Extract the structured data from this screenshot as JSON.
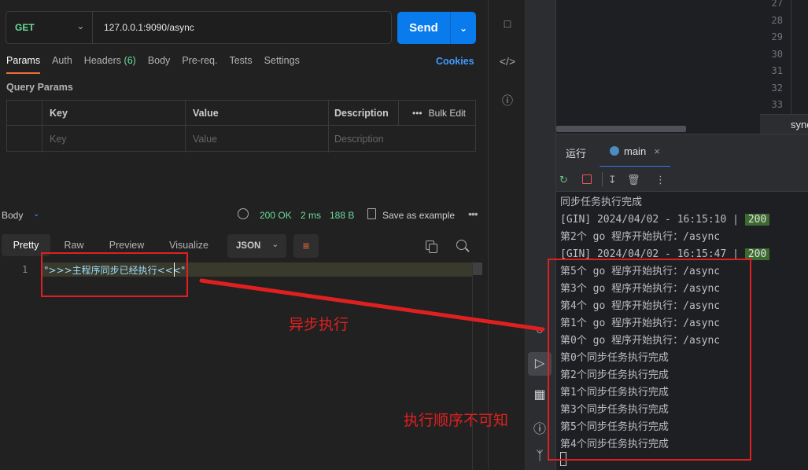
{
  "request": {
    "method": "GET",
    "url": "127.0.0.1:9090/async",
    "send_label": "Send"
  },
  "tabs": [
    {
      "label": "Params"
    },
    {
      "label": "Auth"
    },
    {
      "label": "Headers",
      "count": "(6)"
    },
    {
      "label": "Body"
    },
    {
      "label": "Pre-req."
    },
    {
      "label": "Tests"
    },
    {
      "label": "Settings"
    }
  ],
  "cookies_label": "Cookies",
  "query_params": {
    "title": "Query Params",
    "headers": {
      "key": "Key",
      "value": "Value",
      "description": "Description",
      "bulk_edit": "Bulk Edit"
    },
    "placeholders": {
      "key": "Key",
      "value": "Value",
      "description": "Description"
    }
  },
  "response": {
    "body_label": "Body",
    "status": "200 OK",
    "time": "2 ms",
    "size": "188 B",
    "save_label": "Save as example",
    "view_tabs": [
      "Pretty",
      "Raw",
      "Preview",
      "Visualize"
    ],
    "format": "JSON",
    "line_number": "1",
    "body_text": "\">>>主程序同步已经执行<<<\""
  },
  "ide": {
    "line_numbers": [
      "27",
      "28",
      "29",
      "30",
      "31",
      "32",
      "33"
    ],
    "code_tab": "sync(cont",
    "run_title": "运行",
    "run_tab": "main",
    "console_lines": [
      "同步任务执行完成",
      "[GIN] 2024/04/02 - 16:15:10 |",
      "第2个 go 程序开始执行：/async",
      "[GIN] 2024/04/02 - 16:15:47 |",
      "第5个 go 程序开始执行：/async",
      "第3个 go 程序开始执行：/async",
      "第4个 go 程序开始执行：/async",
      "第1个 go 程序开始执行：/async",
      "第0个 go 程序开始执行：/async",
      "第0个同步任务执行完成",
      "第2个同步任务执行完成",
      "第1个同步任务执行完成",
      "第3个同步任务执行完成",
      "第5个同步任务执行完成",
      "第4个同步任务执行完成"
    ],
    "status_code": "200"
  },
  "annotations": {
    "async_label": "异步执行",
    "order_label": "执行顺序不可知"
  },
  "colors": {
    "accent": "#097bed",
    "success": "#6bdd9a",
    "annotation": "#e02020",
    "tab_underline": "#f26b3a"
  }
}
